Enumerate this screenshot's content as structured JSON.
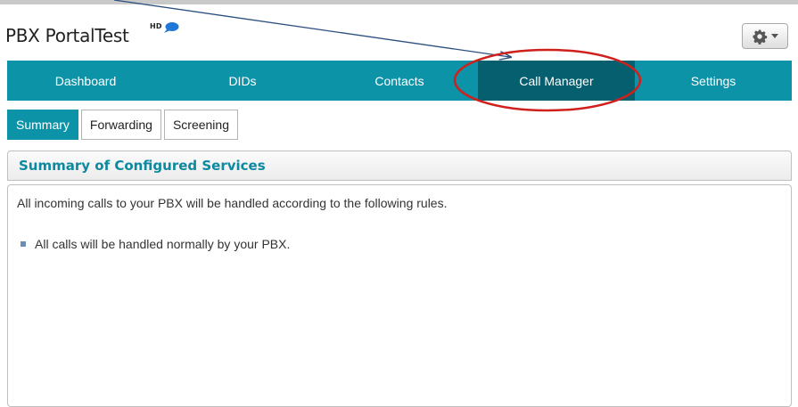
{
  "header": {
    "brand": "PBX PortalTest",
    "badge": "HD",
    "gear_button_icon": "gear-icon",
    "gear_dropdown_icon": "caret-down-icon"
  },
  "nav": {
    "tabs": [
      {
        "label": "Dashboard",
        "active": false
      },
      {
        "label": "DIDs",
        "active": false
      },
      {
        "label": "Contacts",
        "active": false
      },
      {
        "label": "Call Manager",
        "active": true
      },
      {
        "label": "Settings",
        "active": false
      }
    ]
  },
  "subtabs": [
    {
      "label": "Summary",
      "active": true
    },
    {
      "label": "Forwarding",
      "active": false
    },
    {
      "label": "Screening",
      "active": false
    }
  ],
  "panel": {
    "title": "Summary of Configured Services",
    "intro": "All incoming calls to your PBX will be handled according to the following rules.",
    "rules": [
      "All calls will be handled normally by your PBX."
    ]
  },
  "colors": {
    "accent": "#0c93a7",
    "active_nav": "#065f6f",
    "panel_title": "#0c89a0",
    "annotation_circle": "#d0201c",
    "annotation_arrow": "#2b4f7e"
  }
}
